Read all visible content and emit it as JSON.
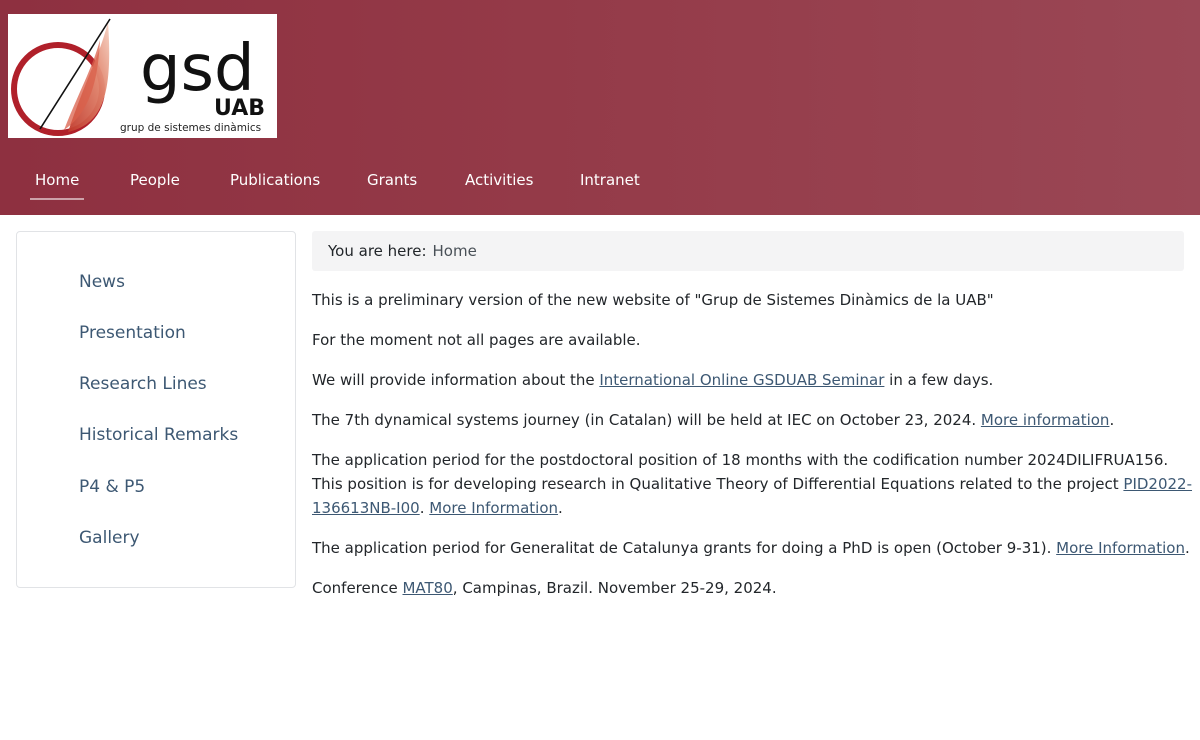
{
  "header": {
    "logo": {
      "main_text": "gsd",
      "sub_text": "UAB",
      "tagline": "grup de sistemes dinàmics"
    },
    "nav": [
      {
        "label": "Home",
        "active": true
      },
      {
        "label": "People"
      },
      {
        "label": "Publications"
      },
      {
        "label": "Grants"
      },
      {
        "label": "Activities"
      },
      {
        "label": "Intranet"
      }
    ]
  },
  "sidebar": {
    "items": [
      {
        "label": "News"
      },
      {
        "label": "Presentation"
      },
      {
        "label": "Research Lines"
      },
      {
        "label": "Historical Remarks"
      },
      {
        "label": "P4 & P5"
      },
      {
        "label": "Gallery"
      }
    ]
  },
  "breadcrumb": {
    "prefix": "You are here:",
    "current": "Home"
  },
  "main": {
    "p1": "This is a preliminary version of the new website of \"Grup de Sistemes Dinàmics de la UAB\"",
    "p2": "For the moment not all pages are available.",
    "p3": {
      "before": "We will provide information about the ",
      "link": "International Online GSDUAB Seminar",
      "after": " in a few days."
    },
    "p4": {
      "before": "The 7th dynamical systems journey (in Catalan) will be held at IEC on October 23, 2024. ",
      "link": "More information",
      "after": "."
    },
    "p5": {
      "before": "The application period for the postdoctoral position of 18 months with the codification number 2024DILIFRUA156. This position is for developing research in Qualitative Theory of Differential Equations related to the project ",
      "link1": "PID2022-136613NB-I00",
      "middle": ". ",
      "link2": "More Information",
      "after": "."
    },
    "p6": {
      "before": "The application period for Generalitat de Catalunya grants for doing a PhD is open (October 9-31). ",
      "link": "More Information",
      "after": "."
    },
    "p7": {
      "before": "Conference ",
      "link": "MAT80",
      "after": ", Campinas, Brazil. November 25-29, 2024."
    }
  },
  "colors": {
    "header_bg": "#943a48",
    "link": "#3d5873",
    "logo_red": "#b8242c"
  }
}
